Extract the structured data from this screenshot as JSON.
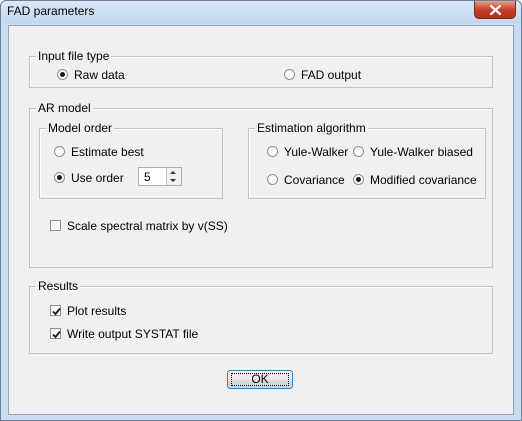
{
  "window": {
    "title": "FAD parameters"
  },
  "input_file_type": {
    "label": "Input file type",
    "options": [
      {
        "label": "Raw data",
        "selected": true
      },
      {
        "label": "FAD output",
        "selected": false
      }
    ]
  },
  "ar_model": {
    "label": "AR model",
    "model_order": {
      "label": "Model order",
      "estimate_best": {
        "label": "Estimate best",
        "selected": false
      },
      "use_order": {
        "label": "Use order",
        "selected": true,
        "value": "5"
      }
    },
    "estimation_algorithm": {
      "label": "Estimation algorithm",
      "options": [
        {
          "label": "Yule-Walker",
          "selected": false
        },
        {
          "label": "Yule-Walker biased",
          "selected": false
        },
        {
          "label": "Covariance",
          "selected": false
        },
        {
          "label": "Modified covariance",
          "selected": true
        }
      ]
    },
    "scale_spectral": {
      "label": "Scale spectral matrix by v(SS)",
      "checked": false
    }
  },
  "results": {
    "label": "Results",
    "plot_results": {
      "label": "Plot results",
      "checked": true
    },
    "write_output": {
      "label": "Write output SYSTAT file",
      "checked": true
    }
  },
  "buttons": {
    "ok": "OK"
  }
}
